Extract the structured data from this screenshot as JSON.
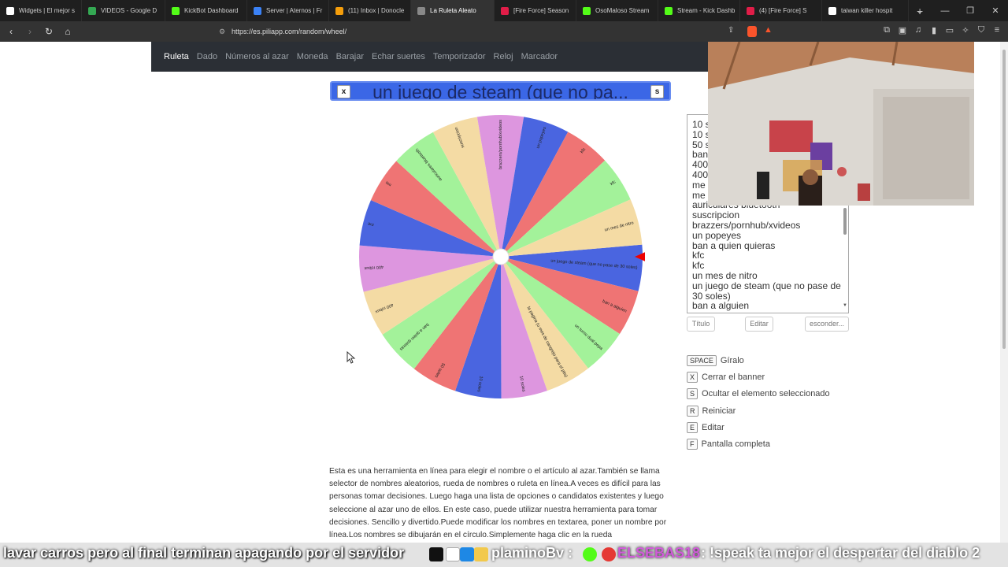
{
  "browser": {
    "tabs": [
      {
        "label": "Widgets | El mejor s",
        "color": "#ffffff"
      },
      {
        "label": "VIDEOS - Google D",
        "color": "#34a853"
      },
      {
        "label": "KickBot Dashboard",
        "color": "#53fc18"
      },
      {
        "label": "Server | Aternos | Fr",
        "color": "#3b82f6"
      },
      {
        "label": "(11) Inbox | Donocle",
        "color": "#f59e0b"
      },
      {
        "label": "La Ruleta Aleato",
        "color": "#888888"
      },
      {
        "label": "[Fire Force] Season",
        "color": "#e11d48"
      },
      {
        "label": "OsoMaloso Stream",
        "color": "#53fc18"
      },
      {
        "label": "Stream - Kick Dashb",
        "color": "#53fc18"
      },
      {
        "label": "(4) [Fire Force] S",
        "color": "#e11d48"
      },
      {
        "label": "taiwan killer hospit",
        "color": "#ffffff"
      }
    ],
    "url": "https://es.piliapp.com/random/wheel/"
  },
  "topnav": {
    "items": [
      "Ruleta",
      "Dado",
      "Números al azar",
      "Moneda",
      "Barajar",
      "Echar suertes",
      "Temporizador",
      "Reloj",
      "Marcador"
    ]
  },
  "banner": {
    "title": "un juego de steam (que no pa...",
    "close_label": "x",
    "hide_label": "s"
  },
  "wheel": {
    "slice_labels": [
      "un juego de steam (que no pase de 30 soles)",
      "ban a alguien",
      "un turno dual pepa",
      "la pagina (u mes de cangrejo para el pito)",
      "10 soles",
      "10 soles",
      "50 soles",
      "ban a quien quieras",
      "400 robux",
      "400 robux",
      "me",
      "me",
      "auriculares bluetooth",
      "suscripcion",
      "brazzers/pornhub/xvideos",
      "un popeyes",
      "kfc",
      "kfc",
      "un mes de nitro"
    ],
    "colors": [
      "#4a65e0",
      "#ef7474",
      "#a3f29a",
      "#f4dba4",
      "#dd96df"
    ]
  },
  "textarea": {
    "lines": [
      "10 s",
      "10 s",
      "50 s",
      "ban",
      "400",
      "400",
      "me",
      "me",
      "auriculares bluetooth",
      "suscripcion",
      "brazzers/pornhub/xvideos",
      "un popeyes",
      "ban a quien quieras",
      "kfc",
      "kfc",
      "un mes de nitro",
      "un juego de steam (que no pase de 30 soles)",
      "ban a alguien"
    ]
  },
  "buttons": {
    "title": "Título",
    "edit": "Editar",
    "hide": "esconder..."
  },
  "shortcuts": [
    {
      "key": "SPACE",
      "label": "Gíralo"
    },
    {
      "key": "X",
      "label": "Cerrar el banner"
    },
    {
      "key": "S",
      "label": "Ocultar el elemento seleccionado"
    },
    {
      "key": "R",
      "label": "Reiniciar"
    },
    {
      "key": "E",
      "label": "Editar"
    },
    {
      "key": "F",
      "label": "Pantalla completa"
    }
  ],
  "description": "Esta es una herramienta en línea para elegir el nombre o el artículo al azar.También se llama selector de nombres aleatorios, rueda de nombres o ruleta en línea.A veces es difícil para las personas tomar decisiones. Luego haga una lista de opciones o candidatos existentes y luego seleccione al azar uno de ellos. En este caso, puede utilizar nuestra herramienta para tomar decisiones. Sencillo y divertido.Puede modificar los nombres en textarea, poner un nombre por línea.Los nombres se dibujarán en el círculo.Simplemente haga clic en la rueda",
  "ticker": {
    "message": "lavar carros pero al final terminan apagando por el servidor",
    "user1": "plaminoBv :",
    "user2": "ELSEBAS18",
    "message2": ": !speak ta mejor el despertar del diablo 2"
  }
}
